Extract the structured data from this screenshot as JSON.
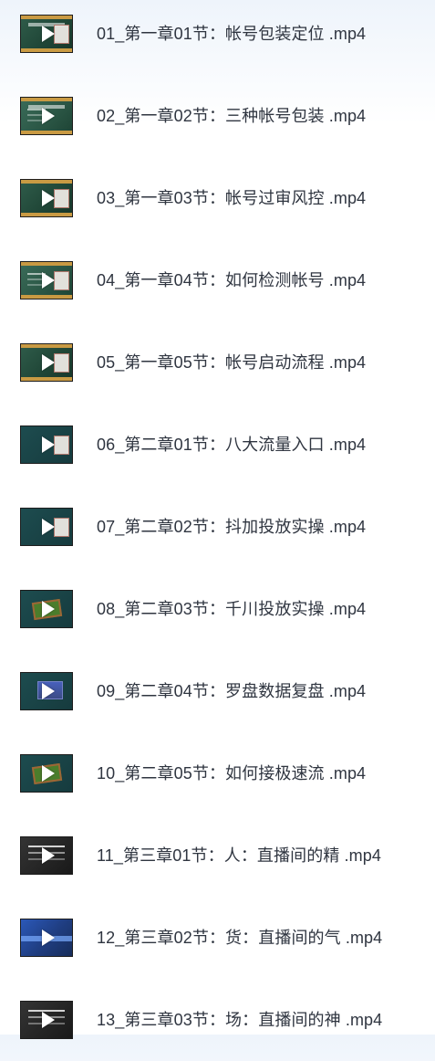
{
  "files": [
    {
      "name": "01_第一章01节：帐号包装定位 .mp4",
      "icon": "play-icon"
    },
    {
      "name": "02_第一章02节：三种帐号包装 .mp4",
      "icon": "play-icon"
    },
    {
      "name": "03_第一章03节：帐号过审风控 .mp4",
      "icon": "play-icon"
    },
    {
      "name": "04_第一章04节：如何检测帐号 .mp4",
      "icon": "play-icon"
    },
    {
      "name": "05_第一章05节：帐号启动流程 .mp4",
      "icon": "play-icon"
    },
    {
      "name": "06_第二章01节：八大流量入口 .mp4",
      "icon": "play-icon"
    },
    {
      "name": "07_第二章02节：抖加投放实操 .mp4",
      "icon": "play-icon"
    },
    {
      "name": "08_第二章03节：千川投放实操 .mp4",
      "icon": "play-icon"
    },
    {
      "name": "09_第二章04节：罗盘数据复盘 .mp4",
      "icon": "play-icon"
    },
    {
      "name": "10_第二章05节：如何接极速流 .mp4",
      "icon": "play-icon"
    },
    {
      "name": "11_第三章01节：人：直播间的精 .mp4",
      "icon": "play-icon"
    },
    {
      "name": "12_第三章02节：货：直播间的气 .mp4",
      "icon": "play-icon"
    },
    {
      "name": "13_第三章03节：场：直播间的神 .mp4",
      "icon": "play-icon"
    }
  ]
}
